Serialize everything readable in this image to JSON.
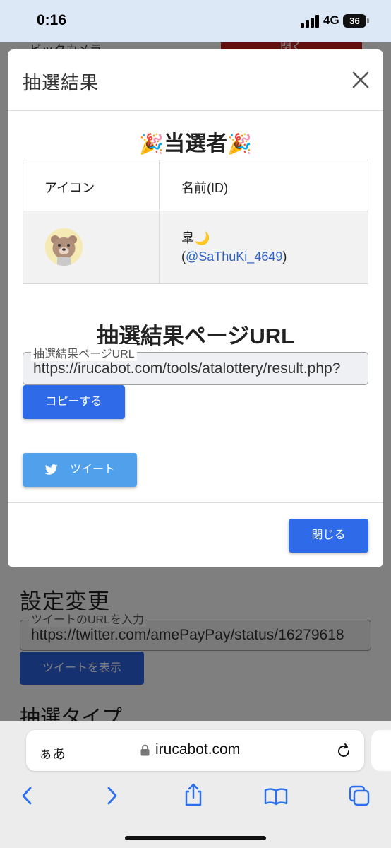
{
  "status_bar": {
    "time": "0:16",
    "network": "4G",
    "battery": "36",
    "battery_level": 0.36
  },
  "background_page": {
    "top_text": "ビックカメラ",
    "top_button": "閉く",
    "heading": "設定変更",
    "field_label": "ツイートのURLを入力",
    "field_value": "https://twitter.com/amePayPay/status/16279618",
    "tweet_display_button": "ツイートを表示",
    "subheading": "抽選タイプ"
  },
  "modal": {
    "title": "抽選結果",
    "winner_title": "当選者",
    "table": {
      "headers": [
        "アイコン",
        "名前(ID)"
      ],
      "rows": [
        {
          "name": "皐🌙",
          "id_prefix": "(",
          "id": "@SaThuKi_4649",
          "id_suffix": ")"
        }
      ]
    },
    "url_heading": "抽選結果ページURL",
    "url_field_label": "抽選結果ページURL",
    "url_field_value": "https://irucabot.com/tools/atalottery/result.php?",
    "copy_button": "コピーする",
    "tweet_button": "ツイート",
    "close_button": "閉じる"
  },
  "browser": {
    "aa_label": "ぁあ",
    "domain": "irucabot.com"
  },
  "colors": {
    "primary": "#2f6ae8",
    "twitter": "#50a0ec",
    "link": "#2f63c9"
  }
}
